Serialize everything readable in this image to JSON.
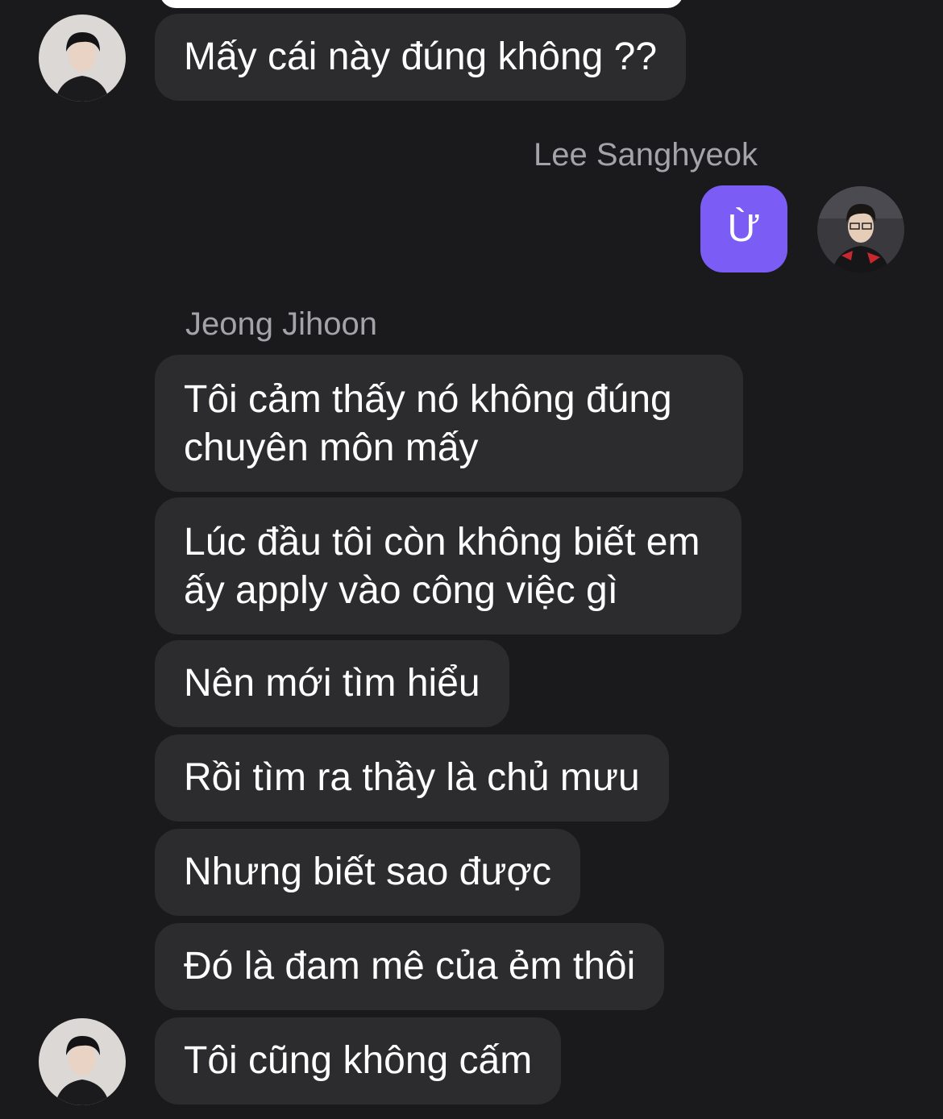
{
  "conversation": {
    "messages": [
      {
        "sender": "Jeong Jihoon",
        "text": "Mấy cái này đúng không ??",
        "direction": "incoming"
      },
      {
        "sender": "Lee Sanghyeok",
        "text": "Ừ",
        "direction": "outgoing"
      },
      {
        "sender": "Jeong Jihoon",
        "text": "Tôi cảm thấy nó không đúng chuyên môn mấy",
        "direction": "incoming"
      },
      {
        "sender": "Jeong Jihoon",
        "text": "Lúc đầu tôi còn không biết em ấy apply vào công việc gì",
        "direction": "incoming"
      },
      {
        "sender": "Jeong Jihoon",
        "text": "Nên mới tìm hiểu",
        "direction": "incoming"
      },
      {
        "sender": "Jeong Jihoon",
        "text": "Rồi tìm ra thầy là chủ mưu",
        "direction": "incoming"
      },
      {
        "sender": "Jeong Jihoon",
        "text": "Nhưng biết sao được",
        "direction": "incoming"
      },
      {
        "sender": "Jeong Jihoon",
        "text": "Đó là đam mê của ẻm thôi",
        "direction": "incoming"
      },
      {
        "sender": "Jeong Jihoon",
        "text": "Tôi cũng không cấm",
        "direction": "incoming"
      }
    ],
    "sender_labels": {
      "outgoing": "Lee Sanghyeok",
      "incoming": "Jeong Jihoon"
    }
  },
  "colors": {
    "background": "#1a1a1c",
    "incoming_bubble": "#2c2c2e",
    "outgoing_bubble": "#7b5cf5",
    "sender_name": "#a3a3a8"
  }
}
